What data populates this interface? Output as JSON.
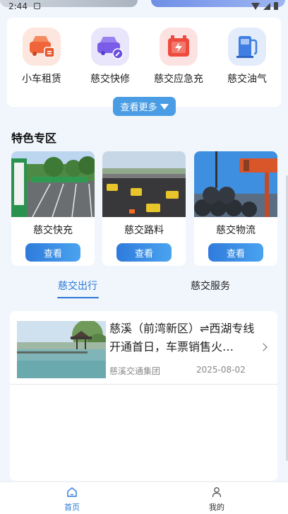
{
  "status": {
    "time": "2:44"
  },
  "services": [
    {
      "label": "小车租赁",
      "icon": "car-rental-icon",
      "bg": "#fde6dd",
      "color": "#f0643a"
    },
    {
      "label": "慈交快修",
      "icon": "car-repair-icon",
      "bg": "#e9e6fb",
      "color": "#7a5ce8"
    },
    {
      "label": "慈交应急充",
      "icon": "battery-charge-icon",
      "bg": "#fde2e2",
      "color": "#ef4a3e"
    },
    {
      "label": "慈交油气",
      "icon": "fuel-pump-icon",
      "bg": "#e2ecfb",
      "color": "#3f7fe4"
    }
  ],
  "more_button": "查看更多",
  "featured": {
    "title": "特色专区",
    "items": [
      {
        "label": "慈交快充",
        "button": "查看"
      },
      {
        "label": "慈交路料",
        "button": "查看"
      },
      {
        "label": "慈交物流",
        "button": "查看"
      }
    ]
  },
  "tabs": [
    {
      "label": "慈交出行",
      "active": true
    },
    {
      "label": "慈交服务",
      "active": false
    }
  ],
  "news": [
    {
      "title": "慈溪（前湾新区）⇌西湖专线开通首日，车票销售火…",
      "source": "慈溪交通集团",
      "date": "2025-08-02"
    }
  ],
  "nav": [
    {
      "label": "首页",
      "icon": "home-icon",
      "active": true
    },
    {
      "label": "我的",
      "icon": "profile-icon",
      "active": false
    }
  ],
  "colors": {
    "accent": "#2a78d6",
    "button": "#4a9de4"
  }
}
